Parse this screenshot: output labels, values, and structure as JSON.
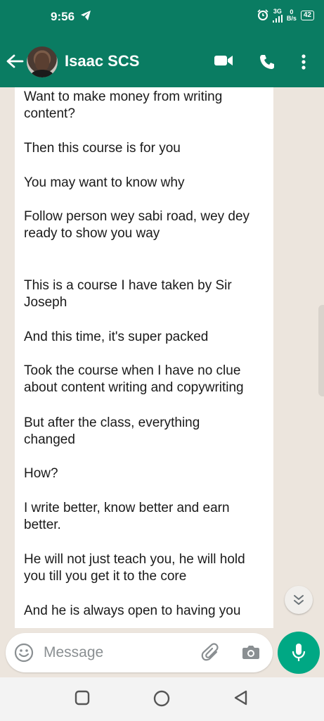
{
  "status_bar": {
    "time": "9:56",
    "network_type": "3G",
    "data_rate_value": "0",
    "data_rate_unit": "B/s",
    "battery": "42"
  },
  "header": {
    "contact_name": "Isaac SCS"
  },
  "message": {
    "lines": [
      "Want to make money from writing\ncontent?",
      "Then this course is for you",
      "You may want to know why",
      "Follow person wey sabi road, wey dey\nready to show you way",
      "This is a course I have taken by Sir\nJoseph",
      "And this time, it's super packed",
      "Took the course when I have no clue\nabout content writing and copywriting",
      "But after the class, everything\nchanged",
      "How?",
      "I write better, know better and earn\nbetter.",
      "He will not just teach you, he will hold\nyou till you get it to the core",
      "And he is always open to having you"
    ]
  },
  "composer": {
    "placeholder": "Message"
  },
  "colors": {
    "header": "#0a7c62",
    "chat_background": "#ece5dd",
    "mic_button": "#00a884"
  }
}
